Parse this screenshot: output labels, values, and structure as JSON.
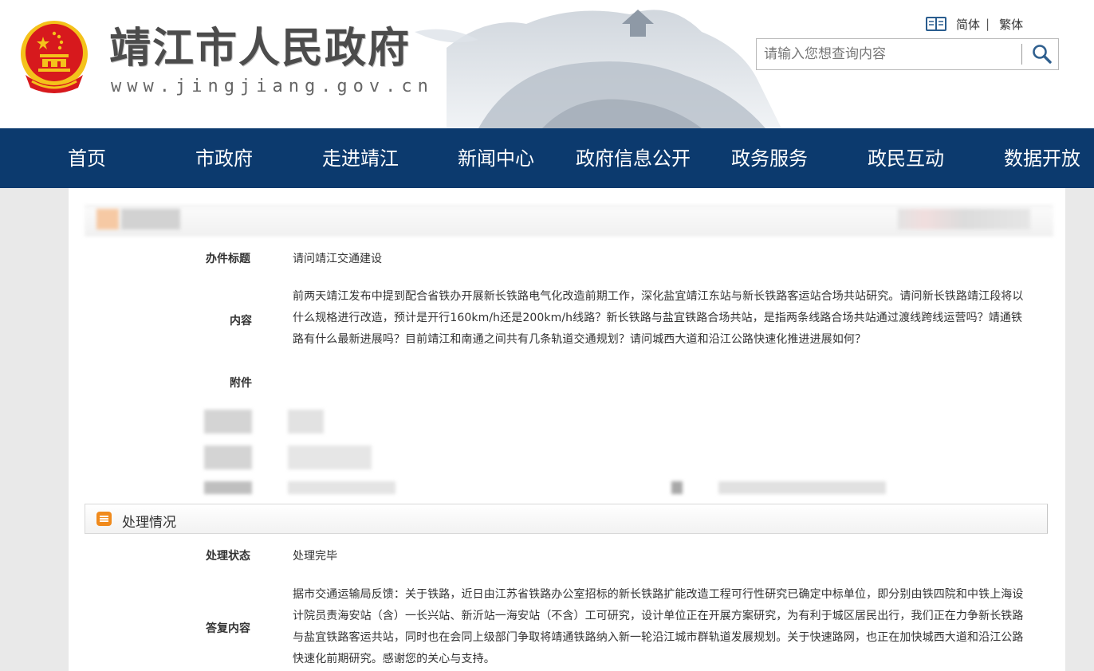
{
  "site": {
    "title": "靖江市人民政府",
    "url": "www.jingjiang.gov.cn"
  },
  "lang": {
    "simplified": "简体",
    "separator": "|",
    "traditional": "繁体"
  },
  "search": {
    "placeholder": "请输入您想查询内容"
  },
  "nav": {
    "items": [
      "首页",
      "市政府",
      "走进靖江",
      "新闻中心",
      "政府信息公开",
      "政务服务",
      "政民互动",
      "数据开放"
    ]
  },
  "inquiry": {
    "title_label": "办件标题",
    "title_value": "请问靖江交通建设",
    "content_label": "内容",
    "content_value": "前两天靖江发布中提到配合省铁办开展新长铁路电气化改造前期工作，深化盐宜靖江东站与新长铁路客运站合场共站研究。请问新长铁路靖江段将以什么规格进行改造，预计是开行160km/h还是200km/h线路？新长铁路与盐宜铁路合场共站，是指两条线路合场共站通过渡线跨线运营吗？靖通铁路有什么最新进展吗？目前靖江和南通之间共有几条轨道交通规划？请问城西大道和沿江公路快速化推进进展如何？",
    "attachment_label": "附件"
  },
  "processing": {
    "section_title": "处理情况",
    "status_label": "处理状态",
    "status_value": "处理完毕",
    "reply_label": "答复内容",
    "reply_value": "据市交通运输局反馈：关于铁路，近日由江苏省铁路办公室招标的新长铁路扩能改造工程可行性研究已确定中标单位，即分别由铁四院和中铁上海设计院员责海安站（含）一长兴站、新沂站一海安站（不含）工可研究，设计单位正在开展方案研究，为有利于城区居民出行，我们正在力争新长铁路与盐宜铁路客运共站，同时也在会同上级部门争取将靖通铁路纳入新一轮沿江城市群轨道发展规划。关于快速路网，也正在加快城西大道和沿江公路快速化前期研究。感谢您的关心与支持。"
  },
  "icons": {
    "emblem": "national-emblem-icon",
    "lang": "book-icon",
    "search": "magnifier-icon",
    "section": "list-icon"
  },
  "colors": {
    "nav_bg": "#0c3a6e",
    "accent_orange": "#f08a1c",
    "emblem_red": "#d7191d",
    "emblem_gold": "#f4c21b"
  }
}
